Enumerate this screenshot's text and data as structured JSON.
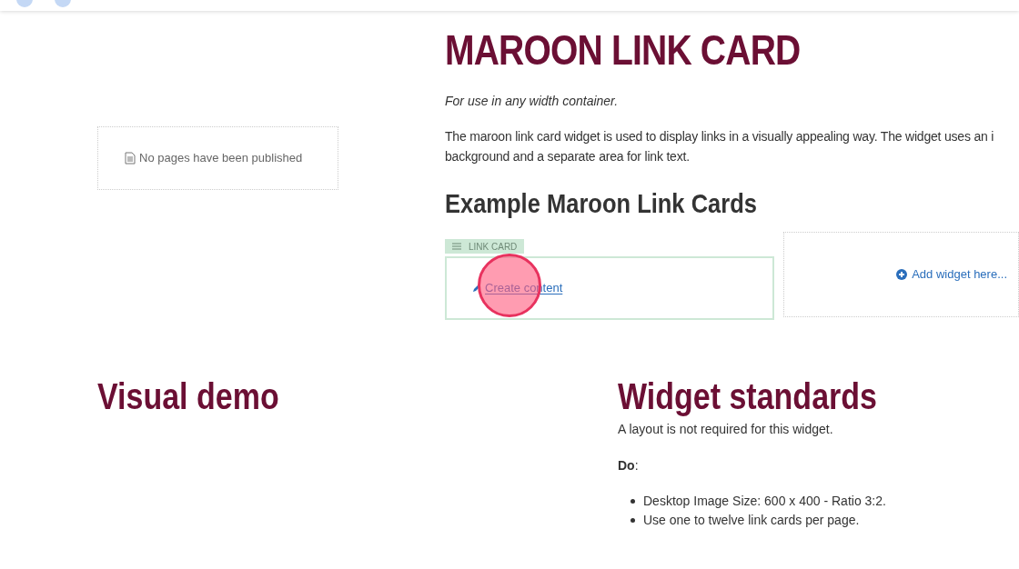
{
  "sidebar": {
    "empty_message": "No pages have been published"
  },
  "main": {
    "title": "MAROON LINK CARD",
    "intro": "For use in any width container.",
    "description_lines": [
      "The maroon link card widget is used to display links in a visually appealing way. The widget uses an i",
      "background and a separate area for link text."
    ],
    "example_heading": "Example Maroon Link Cards",
    "widget": {
      "tag": "LINK CARD",
      "link": "Create content"
    },
    "add_widget": "Add widget here..."
  },
  "click_indicator": {
    "kind": "click"
  },
  "visual_demo": {
    "heading": "Visual demo"
  },
  "standards": {
    "heading": "Widget standards",
    "note": "A layout is not required for this widget.",
    "do_label": "**Do**:",
    "items": [
      "Desktop Image Size: 600 x 400 - Ratio 3:2.",
      "Use one to twelve link cards per page."
    ]
  }
}
